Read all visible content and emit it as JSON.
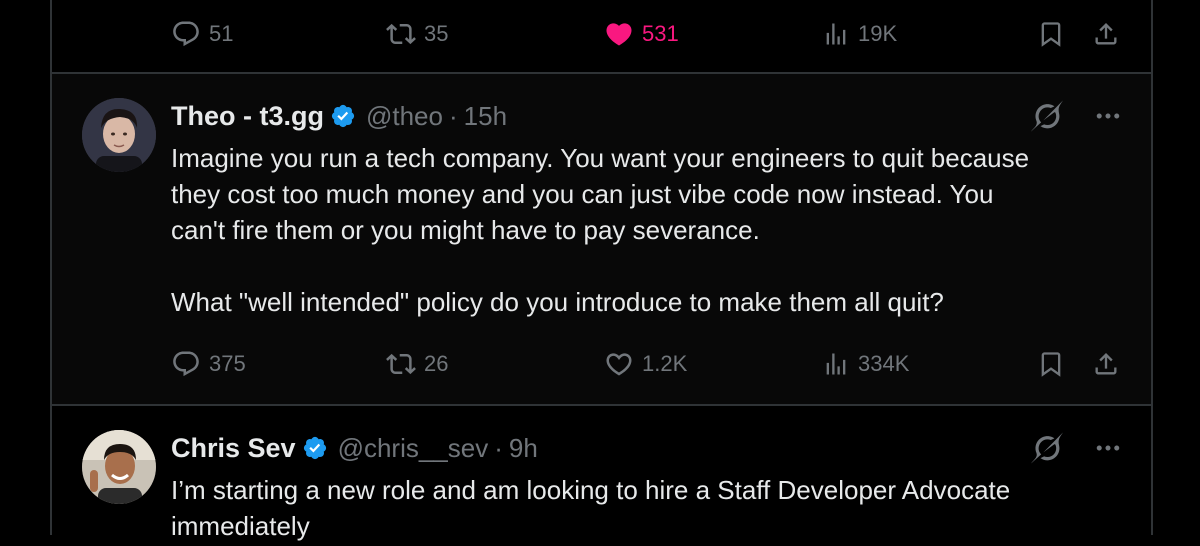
{
  "tweets": [
    {
      "actions": {
        "replies": "51",
        "retweets": "35",
        "likes": "531",
        "views": "19K",
        "liked": true
      }
    },
    {
      "author": {
        "name": "Theo - t3.gg",
        "handle": "@theo",
        "time": "15h",
        "verified": true
      },
      "text": "Imagine you run a tech company. You want your engineers to quit because\nthey cost too much money and you can just vibe code now instead. You\ncan't fire them or you might have to pay severance.\n\nWhat \"well intended\" policy do you introduce to make them all quit?",
      "actions": {
        "replies": "375",
        "retweets": "26",
        "likes": "1.2K",
        "views": "334K",
        "liked": false
      }
    },
    {
      "author": {
        "name": "Chris Sev",
        "handle": "@chris__sev",
        "time": "9h",
        "verified": true
      },
      "text": "I’m starting a new role and am looking to hire a Staff Developer Advocate\nimmediately"
    }
  ],
  "separator": "·",
  "colors": {
    "background": "#000000",
    "text": "#e7e9ea",
    "muted": "#71767b",
    "like": "#f91880",
    "verified": "#1d9bf0",
    "border": "#2f3336"
  },
  "icons": [
    "reply-icon",
    "retweet-icon",
    "heart-icon",
    "views-icon",
    "bookmark-icon",
    "share-icon",
    "grok-icon",
    "more-icon",
    "verified-badge-icon"
  ]
}
